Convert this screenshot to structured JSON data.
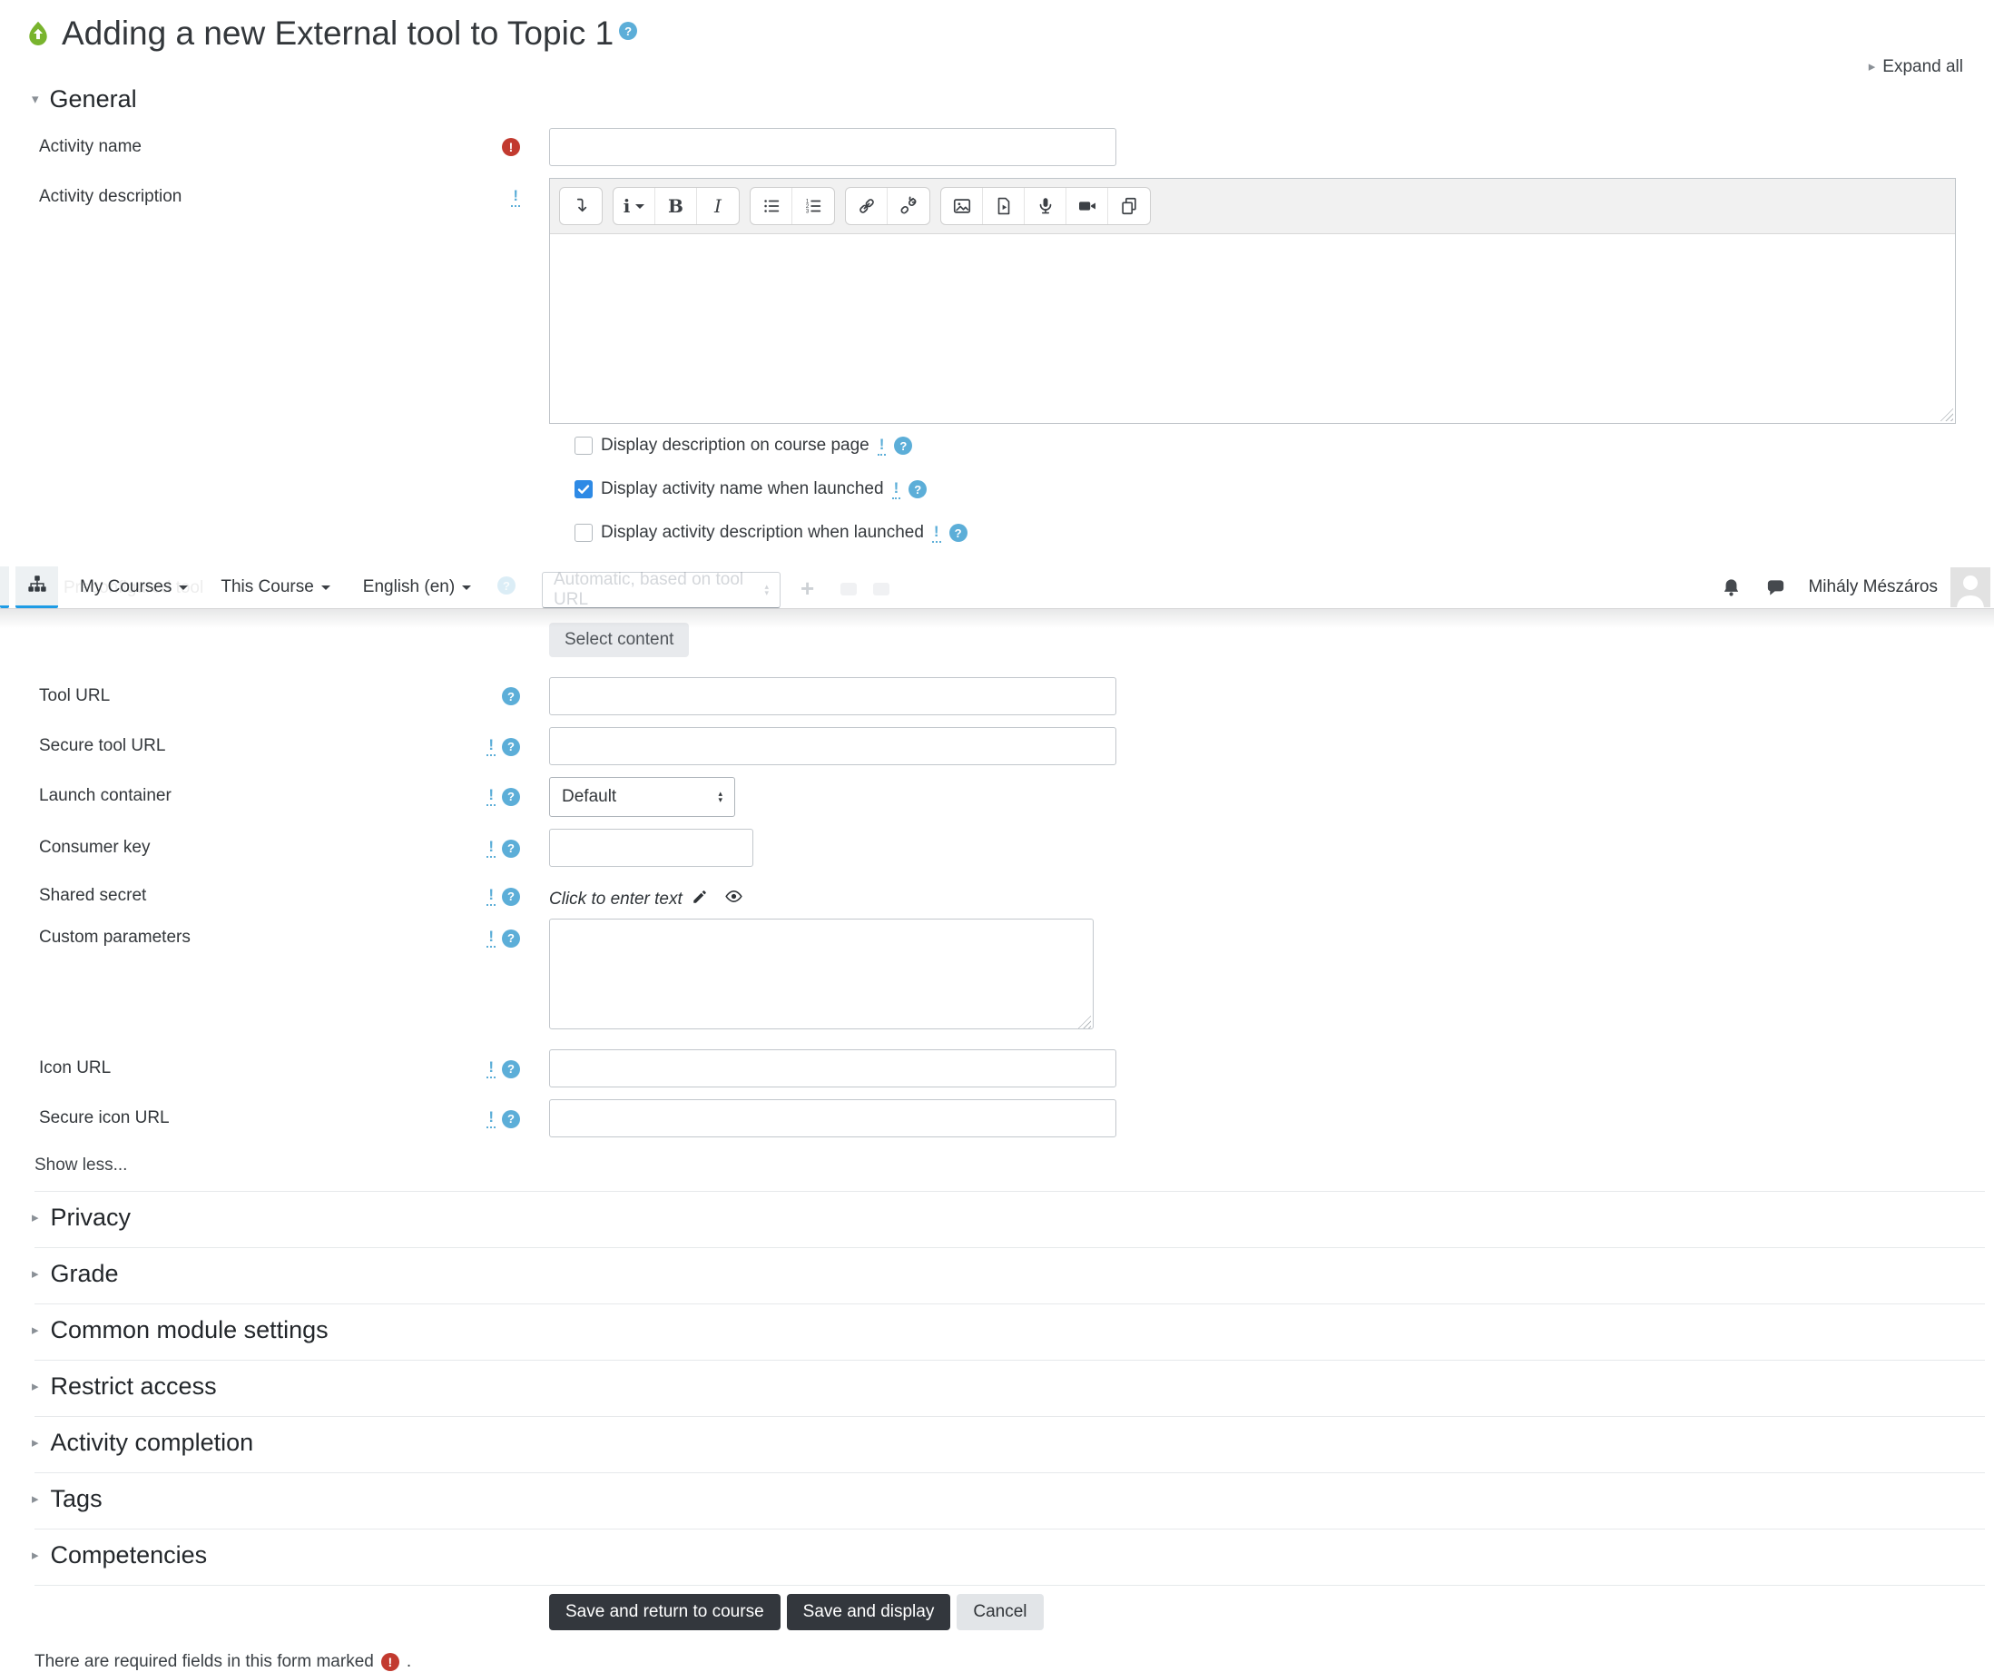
{
  "colors": {
    "accent-blue": "#2e8ae5",
    "help-blue": "#5caed8",
    "required-red": "#c23a2f",
    "tool-green": "#79b42e",
    "button-dark": "#33373d",
    "nav-active-blue": "#1e9ce5"
  },
  "icons": {
    "help": "?",
    "required": "!",
    "required_some": "!",
    "collapsed_triangle": "▸",
    "expanded_triangle": "▾",
    "plus": "+",
    "up_arrow": "▴",
    "down_arrow": "▾"
  },
  "header": {
    "title": "Adding a new External tool to Topic 1",
    "expand_all": "Expand all"
  },
  "navbar": {
    "items": [
      {
        "label": "My Courses"
      },
      {
        "label": "This Course"
      },
      {
        "label": "English (en)"
      }
    ],
    "user_name": "Mihály Mészáros",
    "ghost_field_value": "Automatic, based on tool URL"
  },
  "general": {
    "heading": "General",
    "activity_name": {
      "label": "Activity name",
      "value": ""
    },
    "activity_description": {
      "label": "Activity description",
      "value": ""
    },
    "editor_toolbar_icons": [
      "collapse-toolbar",
      "paragraph-styles",
      "bold",
      "italic",
      "unordered-list",
      "ordered-list",
      "link",
      "unlink",
      "insert-image",
      "insert-media",
      "record-audio",
      "record-video",
      "manage-files"
    ],
    "checkboxes": [
      {
        "label": "Display description on course page",
        "checked": false
      },
      {
        "label": "Display activity name when launched",
        "checked": true
      },
      {
        "label": "Display activity description when launched",
        "checked": false
      }
    ],
    "select_content": "Select content",
    "tool_url": {
      "label": "Tool URL",
      "value": ""
    },
    "secure_tool_url": {
      "label": "Secure tool URL",
      "value": ""
    },
    "launch_container": {
      "label": "Launch container",
      "value": "Default"
    },
    "consumer_key": {
      "label": "Consumer key",
      "value": ""
    },
    "shared_secret": {
      "label": "Shared secret",
      "placeholder_text": "Click to enter text"
    },
    "custom_parameters": {
      "label": "Custom parameters",
      "value": ""
    },
    "icon_url": {
      "label": "Icon URL",
      "value": ""
    },
    "secure_icon_url": {
      "label": "Secure icon URL",
      "value": ""
    },
    "show_less": "Show less..."
  },
  "sections": [
    {
      "label": "Privacy"
    },
    {
      "label": "Grade"
    },
    {
      "label": "Common module settings"
    },
    {
      "label": "Restrict access"
    },
    {
      "label": "Activity completion"
    },
    {
      "label": "Tags"
    },
    {
      "label": "Competencies"
    }
  ],
  "actions": {
    "save_return": "Save and return to course",
    "save_display": "Save and display",
    "cancel": "Cancel"
  },
  "footer": {
    "required_note": "There are required fields in this form marked",
    "suffix": "."
  }
}
